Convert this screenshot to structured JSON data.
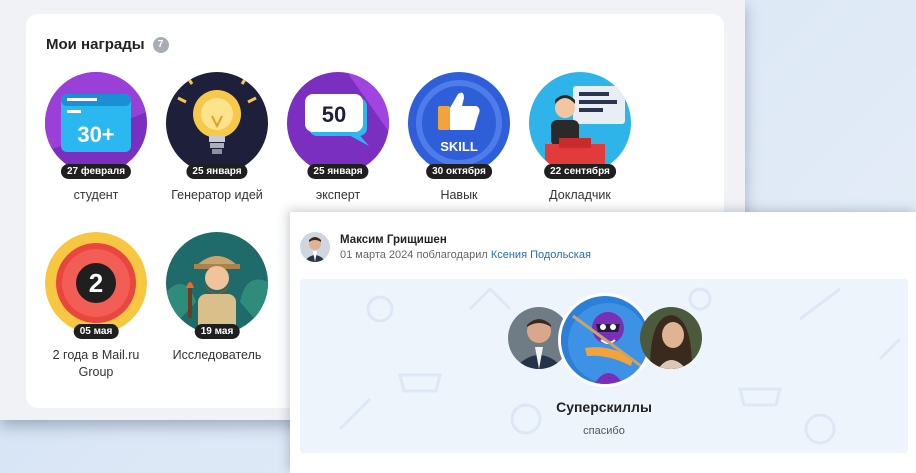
{
  "awards": {
    "title": "Мои награды",
    "count": "7",
    "items": [
      {
        "date": "27 февраля",
        "name": "студент",
        "badge_text": "30+"
      },
      {
        "date": "25 января",
        "name": "Генератор идей"
      },
      {
        "date": "25 января",
        "name": "эксперт",
        "badge_text": "50"
      },
      {
        "date": "30 октября",
        "name": "Навык",
        "badge_text": "SKILL"
      },
      {
        "date": "22 сентября",
        "name": "Докладчик"
      },
      {
        "date": "05 мая",
        "name": "2 года в Mail.ru Group",
        "badge_text": "2"
      },
      {
        "date": "19 мая",
        "name": "Исследователь"
      }
    ]
  },
  "thanks": {
    "author": "Максим Грищишен",
    "date": "01 марта 2024",
    "action": "поблагодарил",
    "recipient": "Ксения Подольская",
    "skill_title": "Суперскиллы",
    "skill_sub": "спасибо"
  }
}
